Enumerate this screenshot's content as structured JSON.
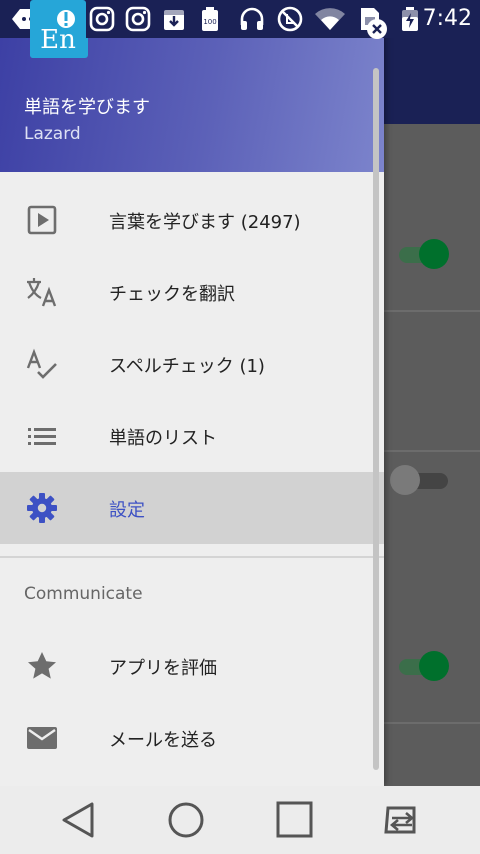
{
  "status_bar": {
    "time": "7:42",
    "icons": [
      "chat-notification-icon",
      "instagram-icon",
      "instagram-icon",
      "download-icon",
      "battery-100-icon",
      "headphones-icon",
      "do-not-disturb-icon",
      "wifi-icon",
      "sim-icon",
      "battery-charging-icon"
    ]
  },
  "drawer": {
    "header": {
      "app_logo_text": "En",
      "title": "単語を学びます",
      "subtitle": "Lazard"
    },
    "items": [
      {
        "label": "言葉を学びます  (2497)",
        "icon": "play-box-icon"
      },
      {
        "label": "チェックを翻訳",
        "icon": "translate-icon"
      },
      {
        "label": "スペルチェック (1)",
        "icon": "spellcheck-icon"
      },
      {
        "label": "単語のリスト",
        "icon": "list-icon"
      },
      {
        "label": "設定",
        "icon": "settings-gear-icon",
        "selected": true
      }
    ],
    "section_title": "Communicate",
    "communicate_items": [
      {
        "label": "アプリを評価",
        "icon": "star-icon"
      },
      {
        "label": "メールを送る",
        "icon": "mail-icon"
      }
    ]
  },
  "background": {
    "toggles": [
      {
        "state": "on"
      },
      {
        "state": "off"
      },
      {
        "state": "on"
      }
    ]
  },
  "colors": {
    "status_bar": "#1a2155",
    "accent": "#3d51c4",
    "toggle_on": "#00702c",
    "drawer_bg": "#eeeeee"
  },
  "navbar": {
    "buttons": [
      "back-icon",
      "home-icon",
      "recents-icon",
      "app-switch-icon"
    ]
  }
}
